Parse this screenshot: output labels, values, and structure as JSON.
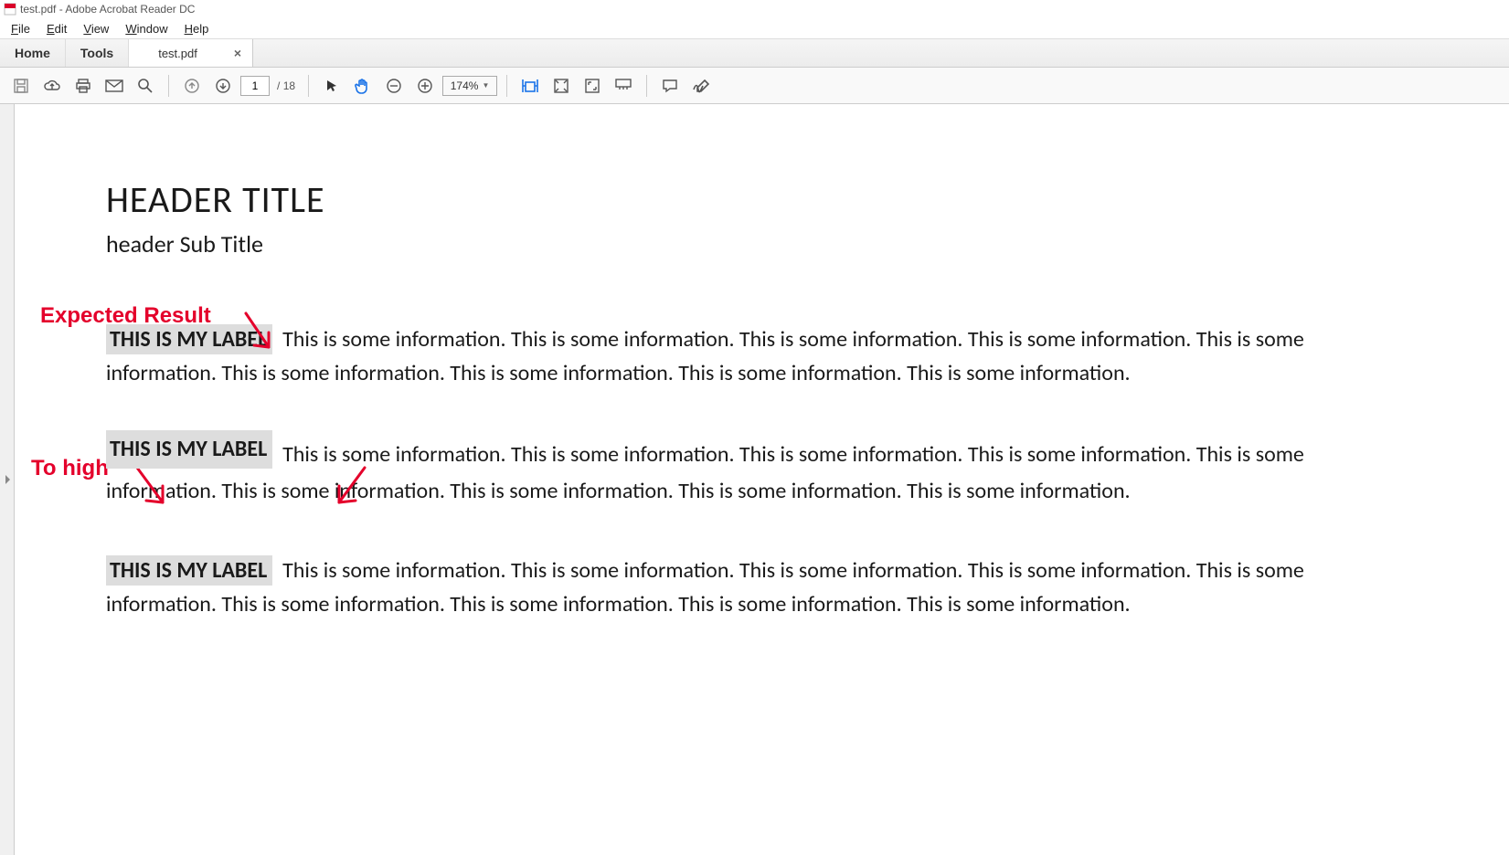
{
  "window": {
    "title": "test.pdf - Adobe Acrobat Reader DC"
  },
  "menu": {
    "file": "File",
    "edit": "Edit",
    "view": "View",
    "window": "Window",
    "help": "Help"
  },
  "tabs": {
    "home": "Home",
    "tools": "Tools",
    "doc": "test.pdf",
    "close_glyph": "×"
  },
  "toolbar": {
    "page_current": "1",
    "page_sep": "/",
    "page_total": "18",
    "zoom": "174%"
  },
  "document": {
    "header_title": "HEADER TITLE",
    "header_sub": "header Sub Title",
    "label_text": "THIS IS MY LABEL",
    "info_text": "This is some information. This is some information. This is some information. This is some information. This is some information. This is some information. This is some information. This is some information. This is some information."
  },
  "annotations": {
    "expected": "Expected Result",
    "too_high": "To high"
  }
}
